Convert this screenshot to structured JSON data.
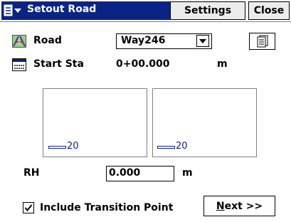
{
  "titlebar": {
    "title": "Setout Road",
    "settings_label": "Settings",
    "close_label": "Close"
  },
  "road": {
    "label": "Road",
    "value": "Way246"
  },
  "start_sta": {
    "label": "Start Sta",
    "value": "0+00.000",
    "unit": "m"
  },
  "panels": [
    {
      "scale": "20"
    },
    {
      "scale": "20"
    }
  ],
  "rh": {
    "label": "RH",
    "value": "0.000",
    "unit": "m"
  },
  "include_transition": {
    "label": "Include Transition Point",
    "checked": true
  },
  "next_button": {
    "mnemonic": "N",
    "rest": "ext >>"
  },
  "colors": {
    "title_blue": "#0a2486",
    "button_gray": "#ececec"
  },
  "icons": [
    "menu-icon",
    "road-icon",
    "start-station-icon",
    "page-icon",
    "dropdown-arrow-icon",
    "checkmark-icon"
  ]
}
